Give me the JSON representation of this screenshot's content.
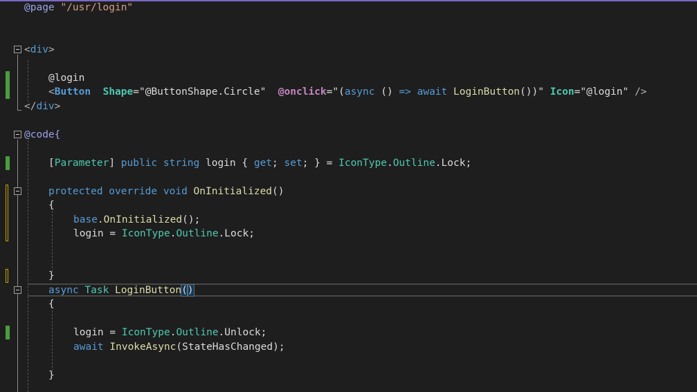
{
  "editor": {
    "lines": {
      "l1": {
        "razor": "@page",
        "path": "\"/usr/login\""
      },
      "l4": {
        "open": "<",
        "tag": "div",
        "close": ">"
      },
      "l6": {
        "text": "@login"
      },
      "l7": {
        "lt": "<",
        "el": "Button",
        "attr1": "Shape",
        "eq1": "=\"",
        "val1": "@ButtonShape.Circle",
        "q1": "\"",
        "evt": "@onclick",
        "eq2": "=\"",
        "a1": "(",
        "async": "async",
        "a2": " () ",
        "arrow": "=>",
        "await": " await ",
        "method": "LoginButton",
        "a3": "())",
        "q2": "\"",
        "attr3": "Icon",
        "eq3": "=\"",
        "val3": "@login",
        "q3": "\"",
        "end": " />"
      },
      "l8": {
        "open": "</",
        "tag": "div",
        "close": ">"
      },
      "l10": {
        "razor": "@code",
        "brace": "{"
      },
      "l12": {
        "b1": "[",
        "attr": "Parameter",
        "b2": "]",
        "kw1": " public",
        "kw2": " string",
        "name": " login { ",
        "get": "get",
        "semi1": "; ",
        "set": "set",
        "semi2": "; } = ",
        "type": "IconType",
        "dot1": ".",
        "outline": "Outline",
        "dot2": ".",
        "lock": "Lock",
        "semi3": ";"
      },
      "l14": {
        "kw1": "protected",
        "kw2": " override",
        "kw3": " void",
        "method": " OnInitialized",
        "paren": "()"
      },
      "l15": {
        "brace": "{"
      },
      "l16": {
        "base": "base",
        "dot": ".",
        "method": "OnInitialized",
        "rest": "();"
      },
      "l17": {
        "var": "login",
        "eq": " = ",
        "type": "IconType",
        "dot1": ".",
        "outline": "Outline",
        "dot2": ".",
        "lock": "Lock",
        "semi": ";"
      },
      "l20": {
        "brace": "}"
      },
      "l21": {
        "kw": "async",
        "type": " Task",
        "method": " LoginButton",
        "lp": "(",
        "rp": ")"
      },
      "l22": {
        "brace": "{"
      },
      "l24": {
        "var": "login",
        "eq": " = ",
        "type": "IconType",
        "dot1": ".",
        "outline": "Outline",
        "dot2": ".",
        "unlock": "Unlock",
        "semi": ";"
      },
      "l25": {
        "kw": "await",
        "method": " InvokeAsync",
        "lp": "(",
        "arg": "StateHasChanged",
        "rp": ");"
      },
      "l27": {
        "brace": "}"
      }
    }
  }
}
